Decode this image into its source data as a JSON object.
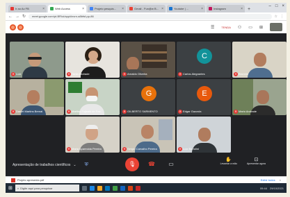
{
  "browser": {
    "tabs": [
      {
        "label": "Ir ao Ac FB",
        "active": false,
        "color": "#e53935"
      },
      {
        "label": "Web Access",
        "active": true,
        "color": "#34a853"
      },
      {
        "label": "Projeto pesquis...",
        "active": false,
        "color": "#4285f4"
      },
      {
        "label": "Gmail - Fun@w B...",
        "active": false,
        "color": "#ea4335"
      },
      {
        "label": "Youtube | ...",
        "active": false,
        "color": "#1976d2"
      },
      {
        "label": "Instagram",
        "active": false,
        "color": "#c2185b"
      }
    ],
    "url": "meet.google.com/pt-BR/ui/app/#xvnr-a8bfsf-pp-86",
    "accent": "#e8572a"
  },
  "meet": {
    "topbar_badge": "TENDA",
    "participants": [
      {
        "name": "Luiz",
        "type": "video"
      },
      {
        "name": "Tania Andrade",
        "type": "video"
      },
      {
        "name": "Arnaldo Oliveira",
        "type": "video"
      },
      {
        "name": "Carlos Alegrantes",
        "type": "avatar",
        "initial": "C",
        "avatar_color": "#12939a"
      },
      {
        "name": "Brunnin",
        "type": "video"
      },
      {
        "name": "Daniel Martins Bernal",
        "type": "video"
      },
      {
        "name": "Martino Fujisaki de Paz",
        "type": "video"
      },
      {
        "name": "GILBERTO SARMENTO",
        "type": "avatar",
        "initial": "G",
        "avatar_color": "#e8710a"
      },
      {
        "name": "Edgar Gazzola",
        "type": "avatar",
        "initial": "E",
        "avatar_color": "#e8590c"
      },
      {
        "name": "Mario Andrade",
        "type": "video"
      },
      {
        "name": "Maria Aparecida Pereira",
        "type": "video"
      },
      {
        "name": "Sergio Carvalho Pereira",
        "type": "video"
      },
      {
        "name": "Luiz Bortolini",
        "type": "video"
      }
    ],
    "meeting_title": "Apresentação de trabalhos científicos",
    "controls": {
      "mic_icon": "microphone-off-icon",
      "hangup_icon": "phone-hangup-icon",
      "camera_icon": "camera-icon"
    },
    "right_buttons": [
      {
        "label": "Levantar a mão",
        "icon": "hand-icon"
      },
      {
        "label": "Apresentar agora",
        "icon": "present-icon"
      }
    ]
  },
  "download_bar": {
    "file": "Projeto apresenta.pdf",
    "show_all": "Exibir todos"
  },
  "taskbar": {
    "search_placeholder": "Digite aqui para pesquisar",
    "time": "09:44",
    "date": "29/10/2021"
  }
}
